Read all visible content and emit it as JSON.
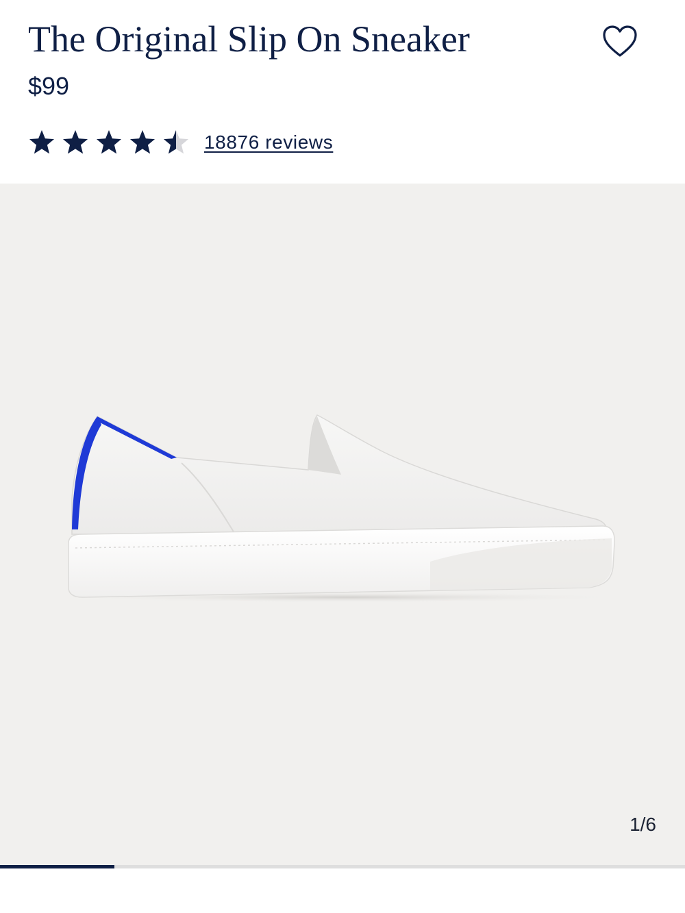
{
  "product": {
    "title": "The Original Slip On Sneaker",
    "price": "$99",
    "rating": {
      "value": 4.5,
      "max": 5,
      "reviews_label": "18876 reviews"
    },
    "wishlist_icon": "heart-outline-icon"
  },
  "gallery": {
    "counter": "1/6",
    "current": 1,
    "total": 6,
    "progress": 0.1667,
    "accent_color": "#1f3ad6"
  },
  "colors": {
    "navy": "#0f1f45",
    "gallery_bg": "#f1f0ee",
    "progress_track": "#dedede"
  }
}
